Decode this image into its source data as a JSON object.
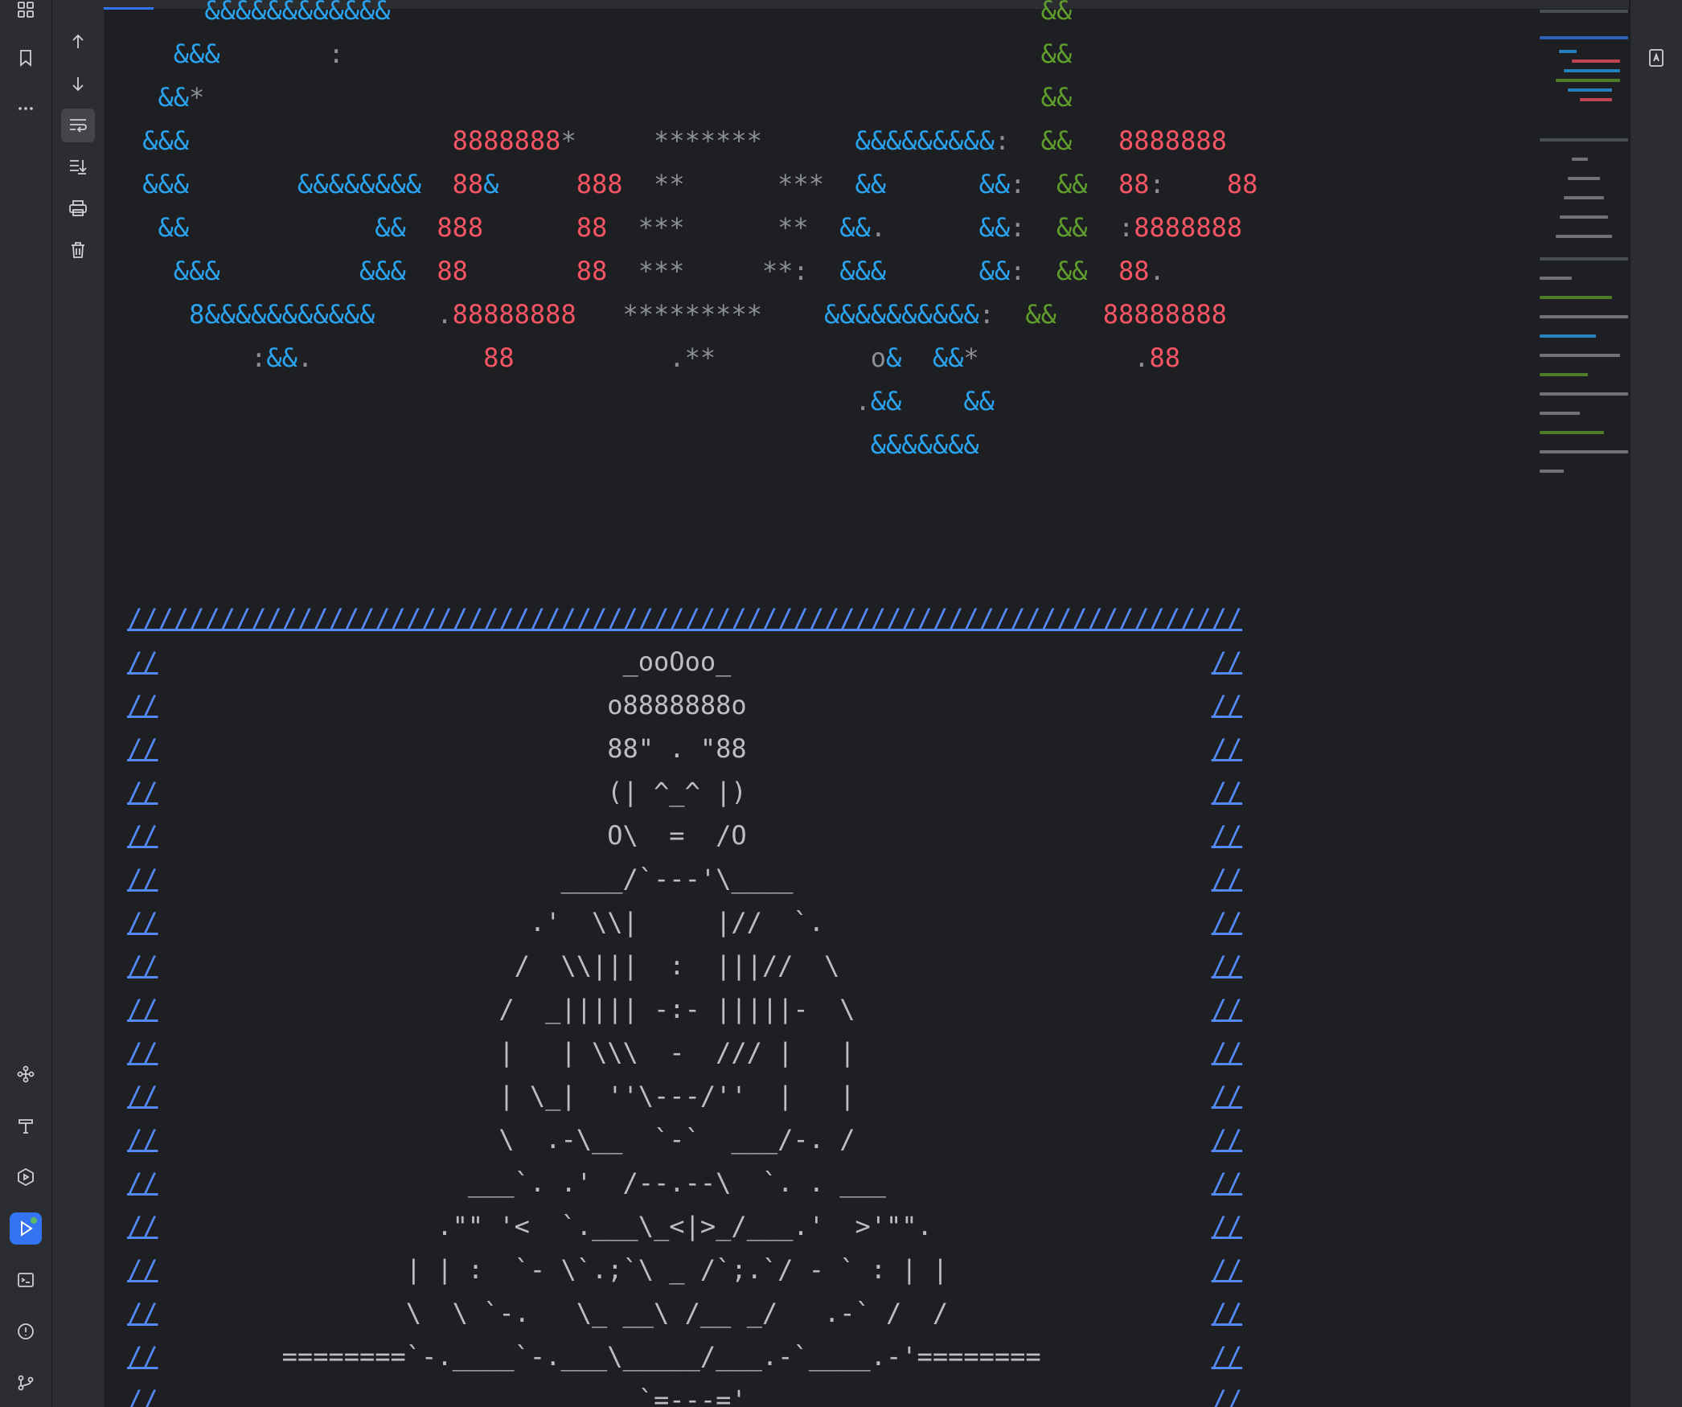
{
  "left_rail": {
    "top_icons": [
      "project-structure-icon",
      "bookmarks-icon",
      "more-icon"
    ],
    "bottom_icons": [
      "plugins-icon",
      "build-icon",
      "services-icon",
      "run-icon",
      "terminal-icon",
      "problems-icon",
      "git-icon"
    ]
  },
  "console_toolbar": {
    "icons": [
      "arrow-up-icon",
      "arrow-down-icon",
      "soft-wrap-icon",
      "scroll-to-end-icon",
      "print-icon",
      "trash-icon"
    ]
  },
  "console": {
    "banner_lines": [
      "     &&&&&&&&&&&&                                          &&",
      "   &&&       :                                             &&",
      "  &&*                                                      &&",
      " &&&                 8888888*     *******      &&&&&&&&&:  &&   8888888",
      " &&&       &&&&&&&&  88&     888  **      ***  &&      &&:  &&  88:    88",
      "  &&            &&  888      88  ***      **  &&.      &&:  &&  :8888888",
      "   &&&         &&&  88       88  ***     **:  &&&      &&:  &&  88.",
      "    8&&&&&&&&&&&    .88888888   *********    &&&&&&&&&&:  &&   88888888",
      "        :&&.           88          .**          o&  &&*          .88",
      "                                               .&&    &&",
      "                                                &&&&&&&"
    ],
    "buddha_lines": [
      "////////////////////////////////////////////////////////////////////////",
      "//                              _ooOoo_                               //",
      "//                             o8888888o                              //",
      "//                             88\" . \"88                              //",
      "//                             (| ^_^ |)                              //",
      "//                             O\\  =  /O                              //",
      "//                          ____/`---'\\____                           //",
      "//                        .'  \\\\|     |//  `.                         //",
      "//                       /  \\\\|||  :  |||//  \\                        //",
      "//                      /  _||||| -:- |||||-  \\                       //",
      "//                      |   | \\\\\\  -  /// |   |                       //",
      "//                      | \\_|  ''\\---/''  |   |                       //",
      "//                      \\  .-\\__  `-`  ___/-. /                       //",
      "//                    ___`. .'  /--.--\\  `. . ___                     //",
      "//                  .\"\" '<  `.___\\_<|>_/___.'  >'\"\".                  //",
      "//                | | :  `- \\`.;`\\ _ /`;.`/ - ` : | |                 //",
      "//                \\  \\ `-.   \\_ __\\ /__ _/   .-` /  /                 //",
      "//        ========`-.____`-.___\\_____/___.-`____.-'========           //",
      "//                               `=---='                              //"
    ]
  },
  "right_rail": {
    "icons": [
      "ai-assistant-icon"
    ]
  },
  "colors": {
    "background": "#1e1f22",
    "panel": "#2b2d30",
    "accent": "#3574f0",
    "ansi_blue": "#2aa3f0",
    "ansi_red": "#f75464",
    "ansi_green": "#5f9e2d",
    "text": "#bcbec4",
    "link": "#548af7"
  }
}
